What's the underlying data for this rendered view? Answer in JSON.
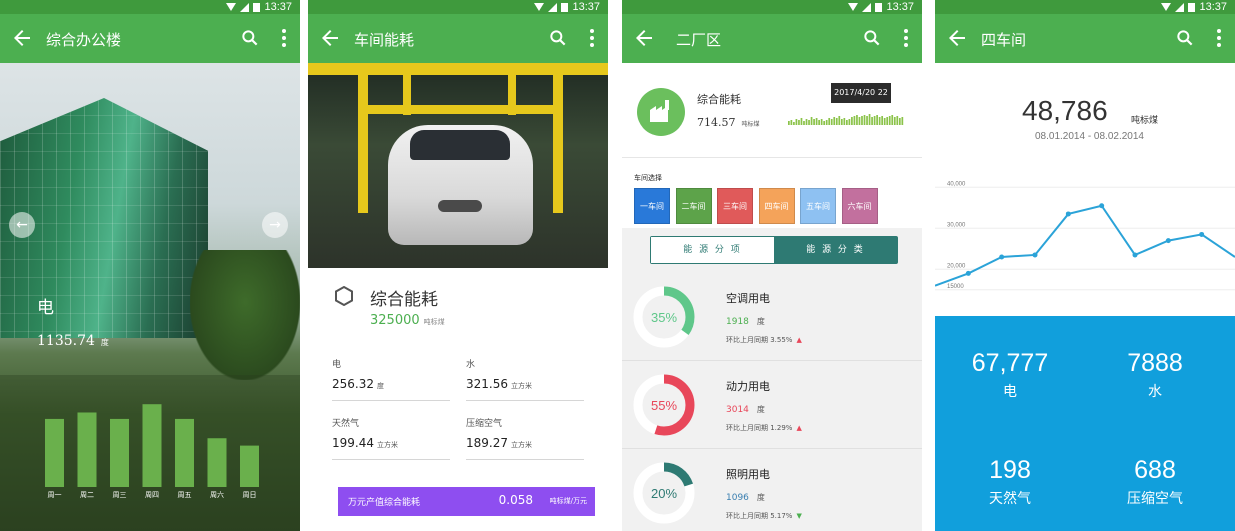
{
  "status": {
    "time": "13:37"
  },
  "screen1": {
    "title": "综合办公楼",
    "label": "电",
    "value": "1135.74",
    "unit": "度",
    "chart_data": {
      "type": "bar",
      "categories": [
        "周一",
        "周二",
        "周三",
        "周四",
        "周五",
        "周六",
        "周日"
      ],
      "values": [
        74,
        81,
        74,
        90,
        74,
        53,
        45
      ],
      "ylim": [
        0,
        100
      ],
      "color": "#6ab04c"
    }
  },
  "screen2": {
    "title": "车间能耗",
    "summary_title": "综合能耗",
    "summary_value": "325000",
    "summary_unit": "吨标煤",
    "cells": [
      {
        "label": "电",
        "value": "256.32",
        "unit": "度"
      },
      {
        "label": "水",
        "value": "321.56",
        "unit": "立方米"
      },
      {
        "label": "天然气",
        "value": "199.44",
        "unit": "立方米"
      },
      {
        "label": "压缩空气",
        "value": "189.27",
        "unit": "立方米"
      }
    ],
    "bar": {
      "label": "万元产值综合能耗",
      "value": "0.058",
      "unit": "吨标煤/万元",
      "color": "#8e4ef0"
    }
  },
  "screen3": {
    "title": "二厂区",
    "summary_title": "综合能耗",
    "summary_value": "714.57",
    "summary_unit": "吨标煤",
    "tooltip": "2017/4/20 22",
    "sparkline": [
      4,
      5,
      3,
      6,
      5,
      7,
      4,
      6,
      5,
      8,
      6,
      7,
      5,
      6,
      4,
      5,
      7,
      6,
      8,
      7,
      9,
      6,
      7,
      5,
      6,
      8,
      9,
      10,
      8,
      9,
      10,
      9,
      11,
      8,
      9,
      10,
      8,
      9,
      7,
      8,
      9,
      10,
      8,
      9,
      7,
      8
    ],
    "workshop_label": "车间选择",
    "workshops": [
      {
        "label": "一车间",
        "color": "#2979d9"
      },
      {
        "label": "二车间",
        "color": "#5da34a"
      },
      {
        "label": "三车间",
        "color": "#e05a5a"
      },
      {
        "label": "四车间",
        "color": "#f4a35a"
      },
      {
        "label": "五车间",
        "color": "#8ec1f2"
      },
      {
        "label": "六车间",
        "color": "#c2709e"
      }
    ],
    "tabs": [
      "能 源 分 项",
      "能 源 分 类"
    ],
    "rows": [
      {
        "title": "空调用电",
        "percent": 35,
        "percent_label": "35%",
        "value": "1918",
        "unit": "度",
        "compare": "环比上月同期  3.55%",
        "trend": "up",
        "color": "#5fc78a",
        "value_color": "#4caf50"
      },
      {
        "title": "动力用电",
        "percent": 55,
        "percent_label": "55%",
        "value": "3014",
        "unit": "度",
        "compare": "环比上月同期  1.29%",
        "trend": "up",
        "color": "#e8475a",
        "value_color": "#e8475a"
      },
      {
        "title": "照明用电",
        "percent": 20,
        "percent_label": "20%",
        "value": "1096",
        "unit": "度",
        "compare": "环比上月同期  5.17%",
        "trend": "down",
        "color": "#2e7a73",
        "value_color": "#3a7fb0"
      }
    ]
  },
  "screen4": {
    "title": "四车间",
    "total": "48,786",
    "total_unit": "吨标煤",
    "range": "08.01.2014 - 08.02.2014",
    "chart_data": {
      "type": "line",
      "y_ticks": [
        "40,000",
        "30,000",
        "20,000",
        "15000"
      ],
      "y_tick_values": [
        40000,
        30000,
        20000,
        15000
      ],
      "values": [
        16000,
        19000,
        23000,
        23500,
        33500,
        35500,
        23500,
        27000,
        28500,
        23000
      ],
      "ylim": [
        13000,
        43000
      ],
      "color": "#2ba3d8"
    },
    "stats": [
      {
        "value": "67,777",
        "label": "电"
      },
      {
        "value": "7888",
        "label": "水"
      },
      {
        "value": "198",
        "label": "天然气"
      },
      {
        "value": "688",
        "label": "压缩空气"
      }
    ]
  }
}
